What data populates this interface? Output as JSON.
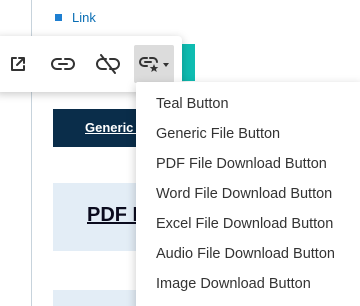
{
  "page": {
    "link_text": "Link",
    "generic_button_text": "Generic File Button",
    "pdf_block_text": "PDF File Download Button"
  },
  "toolbar": {
    "buttons": [
      {
        "icon": "open-in-new-tab-icon",
        "label": "Open link"
      },
      {
        "icon": "link-icon",
        "label": "Link"
      },
      {
        "icon": "unlink-icon",
        "label": "Unlink"
      },
      {
        "icon": "link-style-icon",
        "label": "Link style",
        "active": true
      }
    ]
  },
  "dropdown": {
    "items": [
      "Teal Button",
      "Generic File Button",
      "PDF File Download Button",
      "Word File Download Button",
      "Excel File Download Button",
      "Audio File Download Button",
      "Image Download Button"
    ]
  },
  "colors": {
    "teal": "#0fbcb1",
    "navy": "#0a2d4a",
    "light_blue": "#e3edf6",
    "link_blue": "#0a6eb4",
    "active_button": "#dcdcdc"
  }
}
